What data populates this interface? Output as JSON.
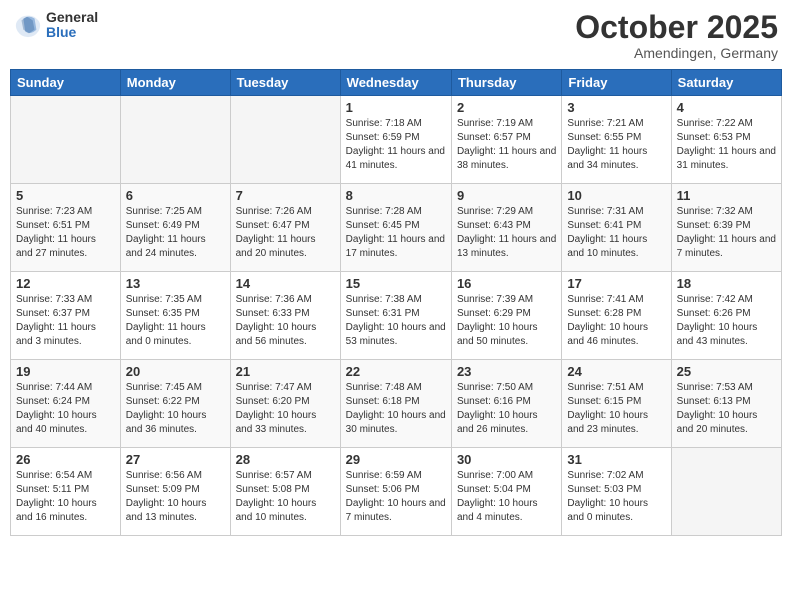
{
  "header": {
    "logo": {
      "general": "General",
      "blue": "Blue"
    },
    "title": "October 2025",
    "location": "Amendingen, Germany"
  },
  "weekdays": [
    "Sunday",
    "Monday",
    "Tuesday",
    "Wednesday",
    "Thursday",
    "Friday",
    "Saturday"
  ],
  "weeks": [
    [
      {
        "day": "",
        "content": ""
      },
      {
        "day": "",
        "content": ""
      },
      {
        "day": "",
        "content": ""
      },
      {
        "day": "1",
        "content": "Sunrise: 7:18 AM\nSunset: 6:59 PM\nDaylight: 11 hours\nand 41 minutes."
      },
      {
        "day": "2",
        "content": "Sunrise: 7:19 AM\nSunset: 6:57 PM\nDaylight: 11 hours\nand 38 minutes."
      },
      {
        "day": "3",
        "content": "Sunrise: 7:21 AM\nSunset: 6:55 PM\nDaylight: 11 hours\nand 34 minutes."
      },
      {
        "day": "4",
        "content": "Sunrise: 7:22 AM\nSunset: 6:53 PM\nDaylight: 11 hours\nand 31 minutes."
      }
    ],
    [
      {
        "day": "5",
        "content": "Sunrise: 7:23 AM\nSunset: 6:51 PM\nDaylight: 11 hours\nand 27 minutes."
      },
      {
        "day": "6",
        "content": "Sunrise: 7:25 AM\nSunset: 6:49 PM\nDaylight: 11 hours\nand 24 minutes."
      },
      {
        "day": "7",
        "content": "Sunrise: 7:26 AM\nSunset: 6:47 PM\nDaylight: 11 hours\nand 20 minutes."
      },
      {
        "day": "8",
        "content": "Sunrise: 7:28 AM\nSunset: 6:45 PM\nDaylight: 11 hours\nand 17 minutes."
      },
      {
        "day": "9",
        "content": "Sunrise: 7:29 AM\nSunset: 6:43 PM\nDaylight: 11 hours\nand 13 minutes."
      },
      {
        "day": "10",
        "content": "Sunrise: 7:31 AM\nSunset: 6:41 PM\nDaylight: 11 hours\nand 10 minutes."
      },
      {
        "day": "11",
        "content": "Sunrise: 7:32 AM\nSunset: 6:39 PM\nDaylight: 11 hours\nand 7 minutes."
      }
    ],
    [
      {
        "day": "12",
        "content": "Sunrise: 7:33 AM\nSunset: 6:37 PM\nDaylight: 11 hours\nand 3 minutes."
      },
      {
        "day": "13",
        "content": "Sunrise: 7:35 AM\nSunset: 6:35 PM\nDaylight: 11 hours\nand 0 minutes."
      },
      {
        "day": "14",
        "content": "Sunrise: 7:36 AM\nSunset: 6:33 PM\nDaylight: 10 hours\nand 56 minutes."
      },
      {
        "day": "15",
        "content": "Sunrise: 7:38 AM\nSunset: 6:31 PM\nDaylight: 10 hours\nand 53 minutes."
      },
      {
        "day": "16",
        "content": "Sunrise: 7:39 AM\nSunset: 6:29 PM\nDaylight: 10 hours\nand 50 minutes."
      },
      {
        "day": "17",
        "content": "Sunrise: 7:41 AM\nSunset: 6:28 PM\nDaylight: 10 hours\nand 46 minutes."
      },
      {
        "day": "18",
        "content": "Sunrise: 7:42 AM\nSunset: 6:26 PM\nDaylight: 10 hours\nand 43 minutes."
      }
    ],
    [
      {
        "day": "19",
        "content": "Sunrise: 7:44 AM\nSunset: 6:24 PM\nDaylight: 10 hours\nand 40 minutes."
      },
      {
        "day": "20",
        "content": "Sunrise: 7:45 AM\nSunset: 6:22 PM\nDaylight: 10 hours\nand 36 minutes."
      },
      {
        "day": "21",
        "content": "Sunrise: 7:47 AM\nSunset: 6:20 PM\nDaylight: 10 hours\nand 33 minutes."
      },
      {
        "day": "22",
        "content": "Sunrise: 7:48 AM\nSunset: 6:18 PM\nDaylight: 10 hours\nand 30 minutes."
      },
      {
        "day": "23",
        "content": "Sunrise: 7:50 AM\nSunset: 6:16 PM\nDaylight: 10 hours\nand 26 minutes."
      },
      {
        "day": "24",
        "content": "Sunrise: 7:51 AM\nSunset: 6:15 PM\nDaylight: 10 hours\nand 23 minutes."
      },
      {
        "day": "25",
        "content": "Sunrise: 7:53 AM\nSunset: 6:13 PM\nDaylight: 10 hours\nand 20 minutes."
      }
    ],
    [
      {
        "day": "26",
        "content": "Sunrise: 6:54 AM\nSunset: 5:11 PM\nDaylight: 10 hours\nand 16 minutes."
      },
      {
        "day": "27",
        "content": "Sunrise: 6:56 AM\nSunset: 5:09 PM\nDaylight: 10 hours\nand 13 minutes."
      },
      {
        "day": "28",
        "content": "Sunrise: 6:57 AM\nSunset: 5:08 PM\nDaylight: 10 hours\nand 10 minutes."
      },
      {
        "day": "29",
        "content": "Sunrise: 6:59 AM\nSunset: 5:06 PM\nDaylight: 10 hours\nand 7 minutes."
      },
      {
        "day": "30",
        "content": "Sunrise: 7:00 AM\nSunset: 5:04 PM\nDaylight: 10 hours\nand 4 minutes."
      },
      {
        "day": "31",
        "content": "Sunrise: 7:02 AM\nSunset: 5:03 PM\nDaylight: 10 hours\nand 0 minutes."
      },
      {
        "day": "",
        "content": ""
      }
    ]
  ]
}
